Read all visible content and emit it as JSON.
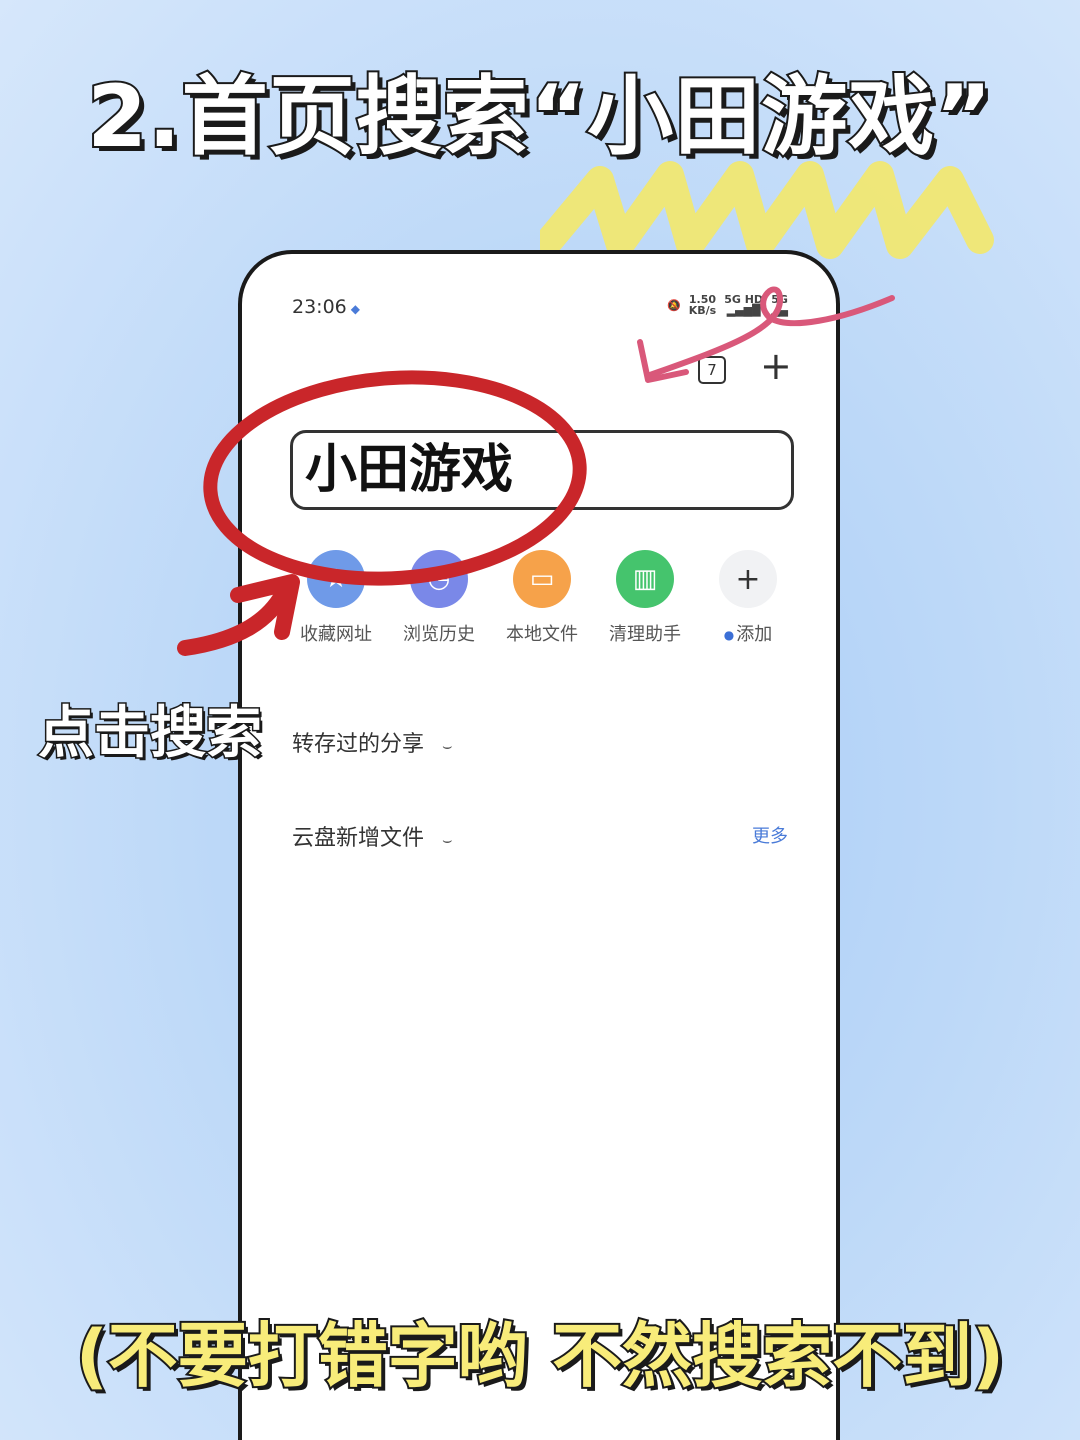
{
  "headline": "2.首页搜索“小田游戏”",
  "phone": {
    "status": {
      "time": "23:06",
      "speed": "1.50",
      "speed_unit": "KB/s",
      "net1": "5G HD",
      "net2": "5G"
    },
    "tab_count": "7",
    "search_text": "小田游戏",
    "shortcuts": [
      {
        "label": "收藏网址"
      },
      {
        "label": "浏览历史"
      },
      {
        "label": "本地文件"
      },
      {
        "label": "清理助手"
      },
      {
        "label": "添加"
      }
    ],
    "sections": [
      {
        "title": "转存过的分享"
      },
      {
        "title": "云盘新增文件"
      }
    ],
    "more_label": "更多"
  },
  "side_note": "点击搜索",
  "bottom_note": "(不要打错字哟 不然搜索不到)",
  "colors": {
    "accent": "#4a7bd8",
    "annotation_red": "#c9262a",
    "annotation_pink": "#d9587a",
    "highlight_yellow": "#f3e86a"
  }
}
